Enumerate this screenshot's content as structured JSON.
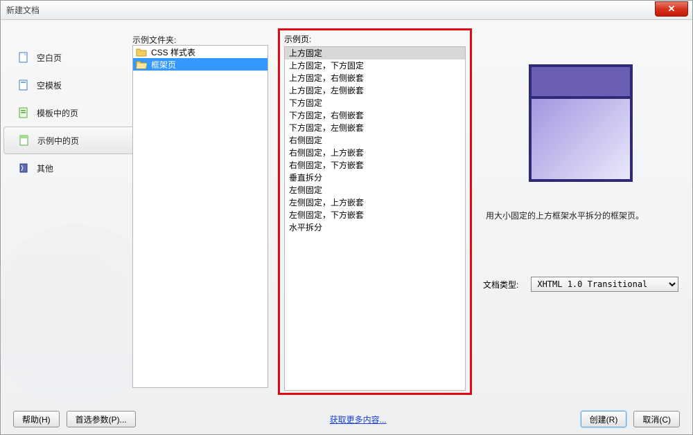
{
  "title": "新建文档",
  "sidebar": {
    "items": [
      {
        "label": "空白页"
      },
      {
        "label": "空模板"
      },
      {
        "label": "模板中的页"
      },
      {
        "label": "示例中的页"
      },
      {
        "label": "其他"
      }
    ]
  },
  "folders": {
    "label": "示例文件夹:",
    "items": [
      {
        "label": "CSS 样式表"
      },
      {
        "label": "框架页"
      }
    ]
  },
  "pages": {
    "label": "示例页:",
    "items": [
      "上方固定",
      "上方固定，下方固定",
      "上方固定，右侧嵌套",
      "上方固定，左侧嵌套",
      "下方固定",
      "下方固定，右侧嵌套",
      "下方固定，左侧嵌套",
      "右侧固定",
      "右侧固定，上方嵌套",
      "右侧固定，下方嵌套",
      "垂直拆分",
      "左侧固定",
      "左侧固定，上方嵌套",
      "左侧固定，下方嵌套",
      "水平拆分"
    ]
  },
  "preview": {
    "description": "用大小固定的上方框架水平拆分的框架页。"
  },
  "doctype": {
    "label": "文档类型:",
    "value": "XHTML 1.0 Transitional"
  },
  "footer": {
    "help": "帮助(H)",
    "prefs": "首选参数(P)...",
    "link": "获取更多内容...",
    "create": "创建(R)",
    "cancel": "取消(C)"
  }
}
